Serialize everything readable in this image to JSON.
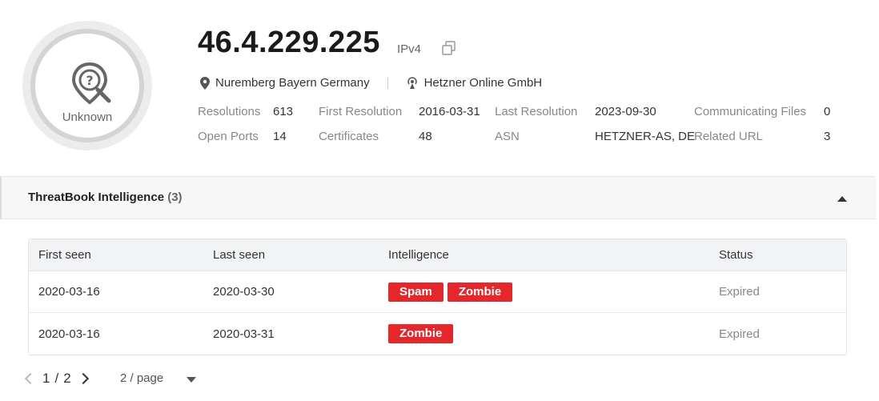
{
  "badge": {
    "label": "Unknown",
    "icon": "unknown-location-icon"
  },
  "ip": {
    "address": "46.4.229.225",
    "type": "IPv4",
    "copy_icon": "copy-icon"
  },
  "meta": {
    "location": "Nuremberg Bayern Germany",
    "location_icon": "map-pin-icon",
    "isp": "Hetzner Online GmbH",
    "isp_icon": "broadcast-icon"
  },
  "stats": {
    "resolutions_label": "Resolutions",
    "resolutions_value": "613",
    "first_resolution_label": "First Resolution",
    "first_resolution_value": "2016-03-31",
    "last_resolution_label": "Last Resolution",
    "last_resolution_value": "2023-09-30",
    "communicating_files_label": "Communicating Files",
    "communicating_files_value": "0",
    "open_ports_label": "Open Ports",
    "open_ports_value": "14",
    "certificates_label": "Certificates",
    "certificates_value": "48",
    "asn_label": "ASN",
    "asn_value": "HETZNER-AS, DE",
    "related_url_label": "Related URL",
    "related_url_value": "3"
  },
  "panel": {
    "title": "ThreatBook Intelligence",
    "count": "(3)"
  },
  "table": {
    "headers": [
      "First seen",
      "Last seen",
      "Intelligence",
      "Status"
    ],
    "rows": [
      {
        "first_seen": "2020-03-16",
        "last_seen": "2020-03-30",
        "tags": [
          "Spam",
          "Zombie"
        ],
        "status": "Expired"
      },
      {
        "first_seen": "2020-03-16",
        "last_seen": "2020-03-31",
        "tags": [
          "Zombie"
        ],
        "status": "Expired"
      }
    ]
  },
  "pager": {
    "current": "1",
    "separator": "/",
    "total": "2",
    "page_size": "2 / page"
  },
  "colors": {
    "tag_red": "#e5262b",
    "ring_gray": "#d4d4d4"
  }
}
